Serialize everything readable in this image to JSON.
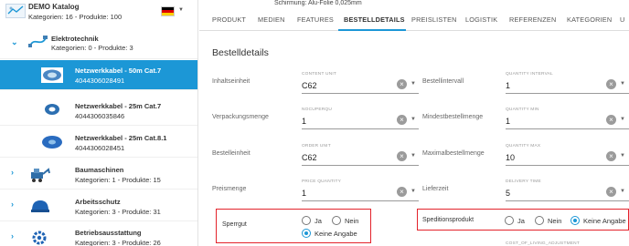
{
  "catalog": {
    "title": "DEMO Katalog",
    "meta": "Kategorien: 16 - Produkte: 100"
  },
  "tree": {
    "elektrotechnik": {
      "title": "Elektrotechnik",
      "meta": "Kategorien: 0 - Produkte: 3"
    },
    "products": [
      {
        "title": "Netzwerkkabel - 50m Cat.7",
        "ean": "4044306028491"
      },
      {
        "title": "Netzwerkkabel - 25m Cat.7",
        "ean": "4044306035846"
      },
      {
        "title": "Netzwerkkabel - 25m Cat.8.1",
        "ean": "4044306028451"
      }
    ],
    "baumaschinen": {
      "title": "Baumaschinen",
      "meta": "Kategorien: 1 - Produkte: 15"
    },
    "arbeitsschutz": {
      "title": "Arbeitsschutz",
      "meta": "Kategorien: 3 - Produkte: 31"
    },
    "betriebsausstattung": {
      "title": "Betriebsausstattung",
      "meta": "Kategorien: 3 - Produkte: 26"
    }
  },
  "topstrip": "Schirmung: Alu-Folie 0,025mm",
  "tabs": [
    "PRODUKT",
    "MEDIEN",
    "FEATURES",
    "BESTELLDETAILS",
    "PREISLISTEN",
    "LOGISTIK",
    "REFERENZEN",
    "KATEGORIEN",
    "U"
  ],
  "active_tab_index": 3,
  "section_title": "Bestelldetails",
  "fields": {
    "inhaltseinheit": {
      "label": "Inhaltseinheit",
      "small": "CONTENT UNIT",
      "value": "C62"
    },
    "bestellintervall": {
      "label": "Bestellintervall",
      "small": "QUANTITY INTERVAL",
      "value": "1"
    },
    "verpackungsmenge": {
      "label": "Verpackungsmenge",
      "small": "NOCUPERQU",
      "value": "1"
    },
    "mindestbestellmenge": {
      "label": "Mindestbestellmenge",
      "small": "QUANTITY MIN",
      "value": "1"
    },
    "bestelleinheit": {
      "label": "Bestelleinheit",
      "small": "ORDER UNIT",
      "value": "C62"
    },
    "maximalbestellmenge": {
      "label": "Maximalbestellmenge",
      "small": "QUANTITY MAX",
      "value": "10"
    },
    "preismenge": {
      "label": "Preismenge",
      "small": "PRICE QUANTITY",
      "value": "1"
    },
    "lieferzeit": {
      "label": "Lieferzeit",
      "small": "DELIVERY TIME",
      "value": "5"
    }
  },
  "sperrgut": {
    "label": "Sperrgut",
    "options": [
      "Ja",
      "Nein",
      "Keine Angabe"
    ],
    "selected": "Keine Angabe"
  },
  "speditionsprodukt": {
    "label": "Speditionsprodukt",
    "options": [
      "Ja",
      "Nein",
      "Keine Angabe"
    ],
    "selected": "Keine Angabe"
  },
  "cut_off_label": "COST_OF_LIVING_ADJUSTMENT",
  "colors": {
    "accent": "#1c97d6",
    "highlight_border": "#e3232b"
  }
}
